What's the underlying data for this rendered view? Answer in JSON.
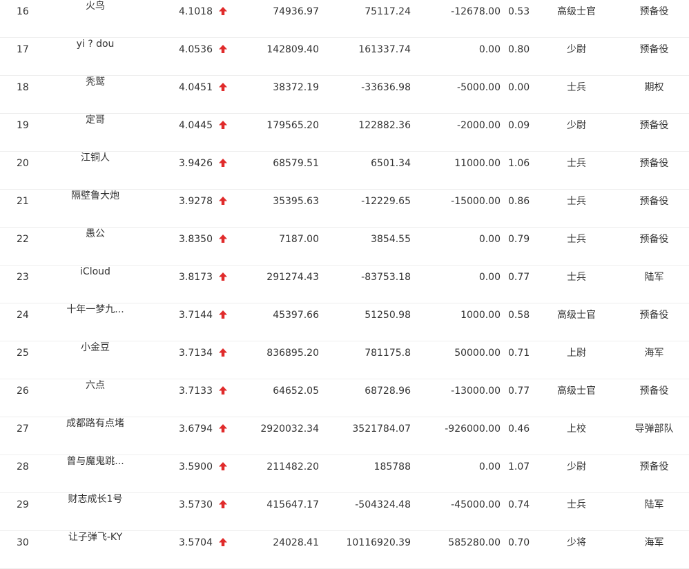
{
  "colors": {
    "up_arrow": "#e02b2b",
    "text": "#333333",
    "divider": "#eeeeee"
  },
  "rows": [
    {
      "rank": "16",
      "name": "火鸟",
      "score": "4.1018",
      "trend_icon": "up-arrow-icon",
      "col1": "74936.97",
      "col2": "75117.24",
      "col3": "-12678.00",
      "col4": "0.53",
      "level": "高级士官",
      "branch": "预备役"
    },
    {
      "rank": "17",
      "name": "yi ? dou",
      "score": "4.0536",
      "trend_icon": "up-arrow-icon",
      "col1": "142809.40",
      "col2": "161337.74",
      "col3": "0.00",
      "col4": "0.80",
      "level": "少尉",
      "branch": "预备役"
    },
    {
      "rank": "18",
      "name": "秃鹫",
      "score": "4.0451",
      "trend_icon": "up-arrow-icon",
      "col1": "38372.19",
      "col2": "-33636.98",
      "col3": "-5000.00",
      "col4": "0.00",
      "level": "士兵",
      "branch": "期权"
    },
    {
      "rank": "19",
      "name": "定哥",
      "score": "4.0445",
      "trend_icon": "up-arrow-icon",
      "col1": "179565.20",
      "col2": "122882.36",
      "col3": "-2000.00",
      "col4": "0.09",
      "level": "少尉",
      "branch": "预备役"
    },
    {
      "rank": "20",
      "name": "江铜人",
      "score": "3.9426",
      "trend_icon": "up-arrow-icon",
      "col1": "68579.51",
      "col2": "6501.34",
      "col3": "11000.00",
      "col4": "1.06",
      "level": "士兵",
      "branch": "预备役"
    },
    {
      "rank": "21",
      "name": "隔壁鲁大炮",
      "score": "3.9278",
      "trend_icon": "up-arrow-icon",
      "col1": "35395.63",
      "col2": "-12229.65",
      "col3": "-15000.00",
      "col4": "0.86",
      "level": "士兵",
      "branch": "预备役"
    },
    {
      "rank": "22",
      "name": "愚公",
      "score": "3.8350",
      "trend_icon": "up-arrow-icon",
      "col1": "7187.00",
      "col2": "3854.55",
      "col3": "0.00",
      "col4": "0.79",
      "level": "士兵",
      "branch": "预备役"
    },
    {
      "rank": "23",
      "name": "iCloud",
      "score": "3.8173",
      "trend_icon": "up-arrow-icon",
      "col1": "291274.43",
      "col2": "-83753.18",
      "col3": "0.00",
      "col4": "0.77",
      "level": "士兵",
      "branch": "陆军"
    },
    {
      "rank": "24",
      "name": "十年一梦九...",
      "score": "3.7144",
      "trend_icon": "up-arrow-icon",
      "col1": "45397.66",
      "col2": "51250.98",
      "col3": "1000.00",
      "col4": "0.58",
      "level": "高级士官",
      "branch": "预备役"
    },
    {
      "rank": "25",
      "name": "小金豆",
      "score": "3.7134",
      "trend_icon": "up-arrow-icon",
      "col1": "836895.20",
      "col2": "781175.8",
      "col3": "50000.00",
      "col4": "0.71",
      "level": "上尉",
      "branch": "海军"
    },
    {
      "rank": "26",
      "name": "六点",
      "score": "3.7133",
      "trend_icon": "up-arrow-icon",
      "col1": "64652.05",
      "col2": "68728.96",
      "col3": "-13000.00",
      "col4": "0.77",
      "level": "高级士官",
      "branch": "预备役"
    },
    {
      "rank": "27",
      "name": "成都路有点堵",
      "score": "3.6794",
      "trend_icon": "up-arrow-icon",
      "col1": "2920032.34",
      "col2": "3521784.07",
      "col3": "-926000.00",
      "col4": "0.46",
      "level": "上校",
      "branch": "导弹部队"
    },
    {
      "rank": "28",
      "name": "曾与魔鬼跳...",
      "score": "3.5900",
      "trend_icon": "up-arrow-icon",
      "col1": "211482.20",
      "col2": "185788",
      "col3": "0.00",
      "col4": "1.07",
      "level": "少尉",
      "branch": "预备役"
    },
    {
      "rank": "29",
      "name": "财志成长1号",
      "score": "3.5730",
      "trend_icon": "up-arrow-icon",
      "col1": "415647.17",
      "col2": "-504324.48",
      "col3": "-45000.00",
      "col4": "0.74",
      "level": "士兵",
      "branch": "陆军"
    },
    {
      "rank": "30",
      "name": "让子弹飞-KY",
      "score": "3.5704",
      "trend_icon": "up-arrow-icon",
      "col1": "24028.41",
      "col2": "10116920.39",
      "col3": "585280.00",
      "col4": "0.70",
      "level": "少将",
      "branch": "海军"
    }
  ]
}
